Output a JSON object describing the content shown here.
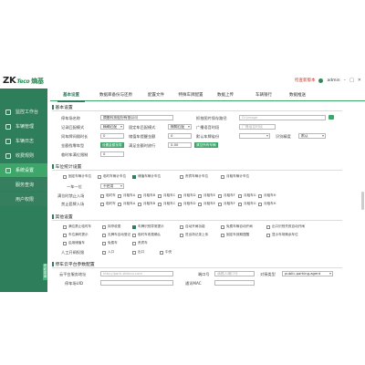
{
  "topbar": {
    "logo_main": "ZK",
    "logo_sub": "Teco",
    "logo_cn": "熵基",
    "version_text": "检查新版本",
    "account_text": "admin",
    "minimize_glyph": "–",
    "maximize_glyph": "□",
    "close_glyph": "✕"
  },
  "sidebar": {
    "items": [
      {
        "label": "监控工作台"
      },
      {
        "label": "车辆管理"
      },
      {
        "label": "车辆日志"
      },
      {
        "label": "收费规则"
      },
      {
        "label": "系统设置",
        "active": true
      },
      {
        "label": "服务查询",
        "sub": true
      },
      {
        "label": "用户权限",
        "sub": true
      }
    ],
    "collapse_label": "收起菜单"
  },
  "tabs": [
    {
      "label": "基本设置",
      "active": true
    },
    {
      "label": "数据库备份与还原"
    },
    {
      "label": "配置文件"
    },
    {
      "label": "特殊车牌配置"
    },
    {
      "label": "数据上传"
    },
    {
      "label": "车辆银行"
    },
    {
      "label": "数据推送"
    }
  ],
  "basic": {
    "title": "基本设置",
    "company_label": "停车场名称",
    "company_value": "熵基科技股份有限公司",
    "image_path_label": "抓拍图片保存路径",
    "image_path_value": "D:\\image",
    "record_mode_label": "记录匹配模式",
    "record_mode_value": "精确匹配",
    "fixed_match_label": "固定车匹配模式",
    "fixed_match_value": "模糊匹配",
    "broadcast_label": "广播语音时段",
    "broadcast_placeholder": "广播语音时段",
    "sync_label": "同车牌间隔时长",
    "sync_value": "0",
    "sync_label2": "储值车提醒金额",
    "sync_value2": "0",
    "default_province_label": "默认车牌省份",
    "recognize_label": "识别精度",
    "recognize_value": "默认",
    "voice_label": "金额找零车型",
    "voice_btn": "设置金额找零",
    "cash_label": "满足金额时放行",
    "cash_value": "0.00",
    "cash_btn": "清空所有车辆",
    "limit_label": "临时车满位限制",
    "limit_value": "0"
  },
  "stats": {
    "title": "车位统计设置",
    "checks": [
      {
        "label": "固定车辆计车位",
        "on": false
      },
      {
        "label": "临时车辆计车位",
        "on": false
      },
      {
        "label": "储值车辆计车位",
        "on": true
      },
      {
        "label": "贵宾车辆计车位",
        "on": false
      },
      {
        "label": "月租车辆计车位",
        "on": false
      }
    ],
    "row2_label": "一车一位",
    "row2_value": "不启用",
    "row3_label": "满位时禁止入场",
    "row3_checks": [
      "临时车",
      "月租车A",
      "月租车B",
      "月租车C",
      "月租车D",
      "月租车E",
      "月租车F",
      "月租车G",
      "月租车H"
    ],
    "row4_label": "禁止套牌入场",
    "row4_checks": [
      "临时车",
      "月租车A",
      "月租车B",
      "月租车C",
      "月租车D",
      "月租车E",
      "月租车F",
      "月租车G",
      "月租车H"
    ]
  },
  "other": {
    "title": "其他设置",
    "row1": [
      {
        "label": "满位禁止临时车",
        "on": false
      },
      {
        "label": "岗亭收费",
        "on": false
      },
      {
        "label": "车牌识别异常提示",
        "on": true
      },
      {
        "label": "自动开闸功能",
        "on": false
      },
      {
        "label": "免费车辆自动开闸",
        "on": false
      },
      {
        "label": "出口识别失败自动开闸",
        "on": false
      }
    ],
    "row2": [
      {
        "label": "车位满时提示",
        "on": false
      },
      {
        "label": "无牌车自动登记",
        "on": false
      },
      {
        "label": "临时车收费确认",
        "on": false
      },
      {
        "label": "进出场记录上传",
        "on": false
      },
      {
        "label": "固定车到期提醒",
        "on": false
      },
      {
        "label": "显示车场剩余车位",
        "on": false
      }
    ],
    "row3": [
      {
        "label": "启用储值车",
        "on": false
      },
      {
        "label": "免费车",
        "on": false
      },
      {
        "label": "贵宾车",
        "on": false
      }
    ],
    "manual_label": "人工开闸权限",
    "manual_checks": [
      "入口",
      "出口",
      "中央"
    ]
  },
  "cloud": {
    "title": "停车云平台参数配置",
    "server_label": "云平台服务地址",
    "server_placeholder": "http://park.zkteco.com",
    "port_label": "端口号",
    "port_placeholder": "请输入端口号",
    "type_label": "对接类型",
    "type_value": "public.parking.agent",
    "park_id_label": "停车场UID",
    "mac_label": "通讯MAC"
  },
  "colors": {
    "sidebar": "#2e7d5b",
    "active_nav": "#3fa66a",
    "accent": "#2e7d5b"
  }
}
